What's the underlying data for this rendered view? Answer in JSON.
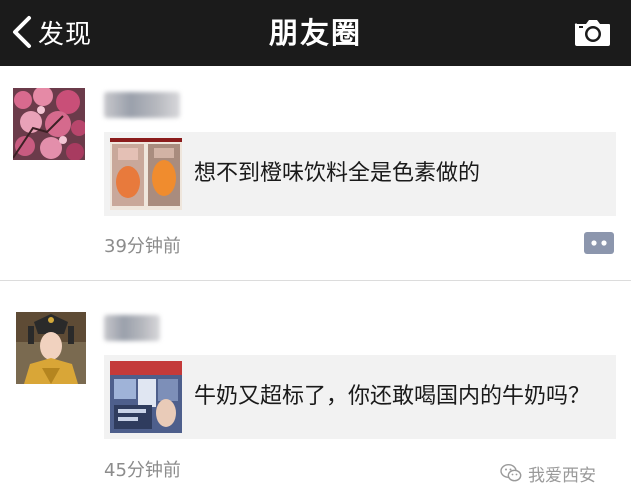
{
  "header": {
    "back_label": "发现",
    "title": "朋友圈",
    "background": "#1b1b1b",
    "icons": {
      "back": "chevron-left-icon",
      "camera": "camera-icon"
    }
  },
  "posts": [
    {
      "share_title": "想不到橙味饮料全是色素做的",
      "time": "39分钟前"
    },
    {
      "share_title": "牛奶又超标了，你还敢喝国内的牛奶吗？",
      "time": "45分钟前"
    }
  ],
  "watermark": {
    "text": "我爱西安",
    "icon": "wechat-icon"
  },
  "colors": {
    "card_bg": "#f2f2f2",
    "comment_btn": "#8c96ad",
    "time_text": "#8c8c8c"
  }
}
